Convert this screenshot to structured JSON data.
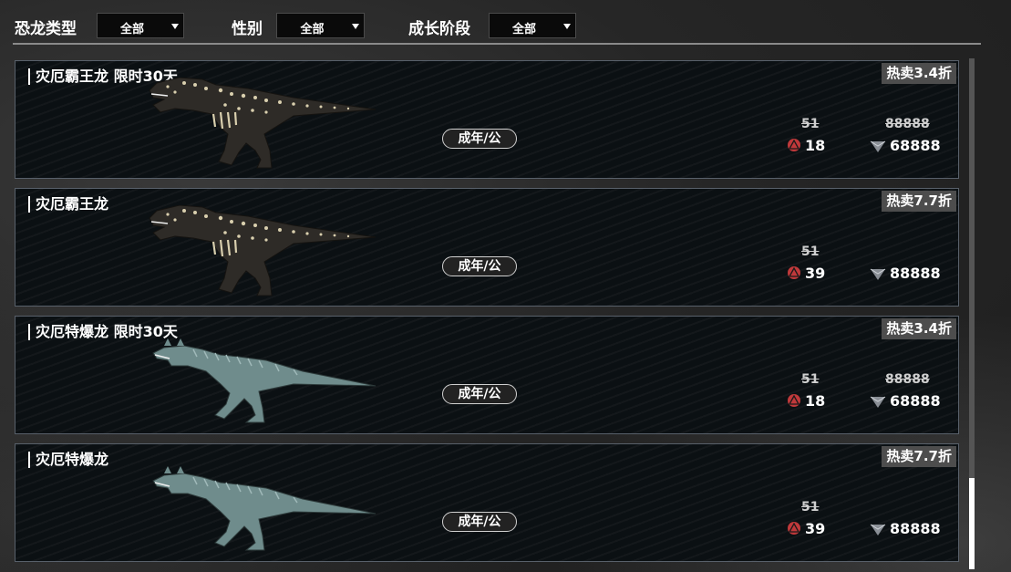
{
  "filters": [
    {
      "label": "恐龙类型",
      "value": "全部"
    },
    {
      "label": "性别",
      "value": "全部"
    },
    {
      "label": "成长阶段",
      "value": "全部"
    }
  ],
  "cards": [
    {
      "title": "灾厄霸王龙 限时30天",
      "dino_icon": "rex-dino-icon",
      "stage": "成年/公",
      "discount": "热卖3.4折",
      "old_ruby": "51",
      "ruby_price": "18",
      "old_gem": "88888",
      "gem_price": "68888"
    },
    {
      "title": "灾厄霸王龙",
      "dino_icon": "rex-dino-icon",
      "stage": "成年/公",
      "discount": "热卖7.7折",
      "old_ruby": "51",
      "ruby_price": "39",
      "old_gem": "",
      "gem_price": "88888"
    },
    {
      "title": "灾厄特爆龙 限时30天",
      "dino_icon": "carno-dino-icon",
      "stage": "成年/公",
      "discount": "热卖3.4折",
      "old_ruby": "51",
      "ruby_price": "18",
      "old_gem": "88888",
      "gem_price": "68888"
    },
    {
      "title": "灾厄特爆龙",
      "dino_icon": "carno-dino-icon",
      "stage": "成年/公",
      "discount": "热卖7.7折",
      "old_ruby": "51",
      "ruby_price": "39",
      "old_gem": "",
      "gem_price": "88888"
    }
  ],
  "colors": {
    "ruby": "#c0393b",
    "gem": "#8a8f96",
    "rex_body": "#2e2b27",
    "rex_spots": "#d9cfae",
    "carno_body": "#6f8c8c"
  }
}
